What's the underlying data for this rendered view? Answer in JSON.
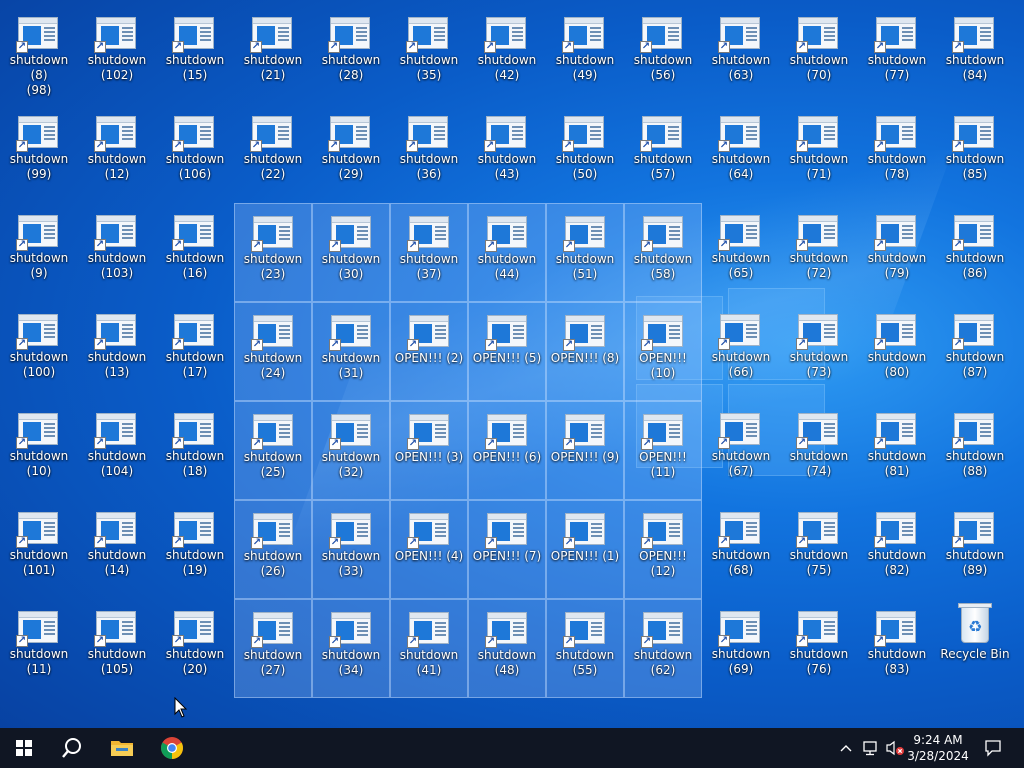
{
  "desktop": {
    "icons": [
      {
        "label": "shutdown (8)\n(98)"
      },
      {
        "label": "shutdown\n(102)"
      },
      {
        "label": "shutdown\n(15)"
      },
      {
        "label": "shutdown\n(21)"
      },
      {
        "label": "shutdown\n(28)"
      },
      {
        "label": "shutdown\n(35)"
      },
      {
        "label": "shutdown\n(42)"
      },
      {
        "label": "shutdown\n(49)"
      },
      {
        "label": "shutdown\n(56)"
      },
      {
        "label": "shutdown\n(63)"
      },
      {
        "label": "shutdown\n(70)"
      },
      {
        "label": "shutdown\n(77)"
      },
      {
        "label": "shutdown\n(84)"
      },
      {
        "label": "shutdown\n(99)"
      },
      {
        "label": "shutdown\n(12)"
      },
      {
        "label": "shutdown\n(106)"
      },
      {
        "label": "shutdown\n(22)"
      },
      {
        "label": "shutdown\n(29)"
      },
      {
        "label": "shutdown\n(36)"
      },
      {
        "label": "shutdown\n(43)"
      },
      {
        "label": "shutdown\n(50)"
      },
      {
        "label": "shutdown\n(57)"
      },
      {
        "label": "shutdown\n(64)"
      },
      {
        "label": "shutdown\n(71)"
      },
      {
        "label": "shutdown\n(78)"
      },
      {
        "label": "shutdown\n(85)"
      },
      {
        "label": "shutdown (9)"
      },
      {
        "label": "shutdown\n(103)"
      },
      {
        "label": "shutdown\n(16)"
      },
      {
        "label": "shutdown\n(23)",
        "selected": true
      },
      {
        "label": "shutdown\n(30)",
        "selected": true
      },
      {
        "label": "shutdown\n(37)",
        "selected": true
      },
      {
        "label": "shutdown\n(44)",
        "selected": true
      },
      {
        "label": "shutdown\n(51)",
        "selected": true
      },
      {
        "label": "shutdown\n(58)",
        "selected": true
      },
      {
        "label": "shutdown\n(65)"
      },
      {
        "label": "shutdown\n(72)"
      },
      {
        "label": "shutdown\n(79)"
      },
      {
        "label": "shutdown\n(86)"
      },
      {
        "label": "shutdown\n(100)"
      },
      {
        "label": "shutdown\n(13)"
      },
      {
        "label": "shutdown\n(17)"
      },
      {
        "label": "shutdown\n(24)",
        "selected": true
      },
      {
        "label": "shutdown\n(31)",
        "selected": true
      },
      {
        "label": "OPEN!!! (2)",
        "selected": true
      },
      {
        "label": "OPEN!!! (5)",
        "selected": true
      },
      {
        "label": "OPEN!!! (8)",
        "selected": true
      },
      {
        "label": "OPEN!!! (10)",
        "selected": true
      },
      {
        "label": "shutdown\n(66)"
      },
      {
        "label": "shutdown\n(73)"
      },
      {
        "label": "shutdown\n(80)"
      },
      {
        "label": "shutdown\n(87)"
      },
      {
        "label": "shutdown\n(10)"
      },
      {
        "label": "shutdown\n(104)"
      },
      {
        "label": "shutdown\n(18)"
      },
      {
        "label": "shutdown\n(25)",
        "selected": true
      },
      {
        "label": "shutdown\n(32)",
        "selected": true
      },
      {
        "label": "OPEN!!! (3)",
        "selected": true
      },
      {
        "label": "OPEN!!! (6)",
        "selected": true
      },
      {
        "label": "OPEN!!! (9)",
        "selected": true
      },
      {
        "label": "OPEN!!! (11)",
        "selected": true
      },
      {
        "label": "shutdown\n(67)"
      },
      {
        "label": "shutdown\n(74)"
      },
      {
        "label": "shutdown\n(81)"
      },
      {
        "label": "shutdown\n(88)"
      },
      {
        "label": "shutdown\n(101)"
      },
      {
        "label": "shutdown\n(14)"
      },
      {
        "label": "shutdown\n(19)"
      },
      {
        "label": "shutdown\n(26)",
        "selected": true
      },
      {
        "label": "shutdown\n(33)",
        "selected": true
      },
      {
        "label": "OPEN!!! (4)",
        "selected": true
      },
      {
        "label": "OPEN!!! (7)",
        "selected": true
      },
      {
        "label": "OPEN!!! (1)",
        "selected": true
      },
      {
        "label": "OPEN!!! (12)",
        "selected": true
      },
      {
        "label": "shutdown\n(68)"
      },
      {
        "label": "shutdown\n(75)"
      },
      {
        "label": "shutdown\n(82)"
      },
      {
        "label": "shutdown\n(89)"
      },
      {
        "label": "shutdown\n(11)"
      },
      {
        "label": "shutdown\n(105)"
      },
      {
        "label": "shutdown\n(20)"
      },
      {
        "label": "shutdown\n(27)",
        "selected": true
      },
      {
        "label": "shutdown\n(34)",
        "selected": true
      },
      {
        "label": "shutdown\n(41)",
        "selected": true
      },
      {
        "label": "shutdown\n(48)",
        "selected": true
      },
      {
        "label": "shutdown\n(55)",
        "selected": true
      },
      {
        "label": "shutdown\n(62)",
        "selected": true
      },
      {
        "label": "shutdown\n(69)"
      },
      {
        "label": "shutdown\n(76)"
      },
      {
        "label": "shutdown\n(83)"
      },
      {
        "label": "Recycle Bin",
        "type": "recycle-bin"
      }
    ]
  },
  "taskbar": {
    "start_icon": "windows-start-icon",
    "search_icon": "search-icon",
    "pinned": [
      {
        "name": "file-explorer-icon"
      },
      {
        "name": "chrome-icon"
      }
    ],
    "tray": {
      "overflow_icon": "chevron-up-icon",
      "network_icon": "network-icon",
      "volume_icon": "volume-muted-icon",
      "notification_icon": "notification-icon"
    },
    "clock": {
      "time": "9:24 AM",
      "date": "3/28/2024"
    }
  },
  "colors": {
    "taskbar": "#101623",
    "accent": "#1e78d8",
    "wallpaper_base": "#0a5cc8"
  }
}
